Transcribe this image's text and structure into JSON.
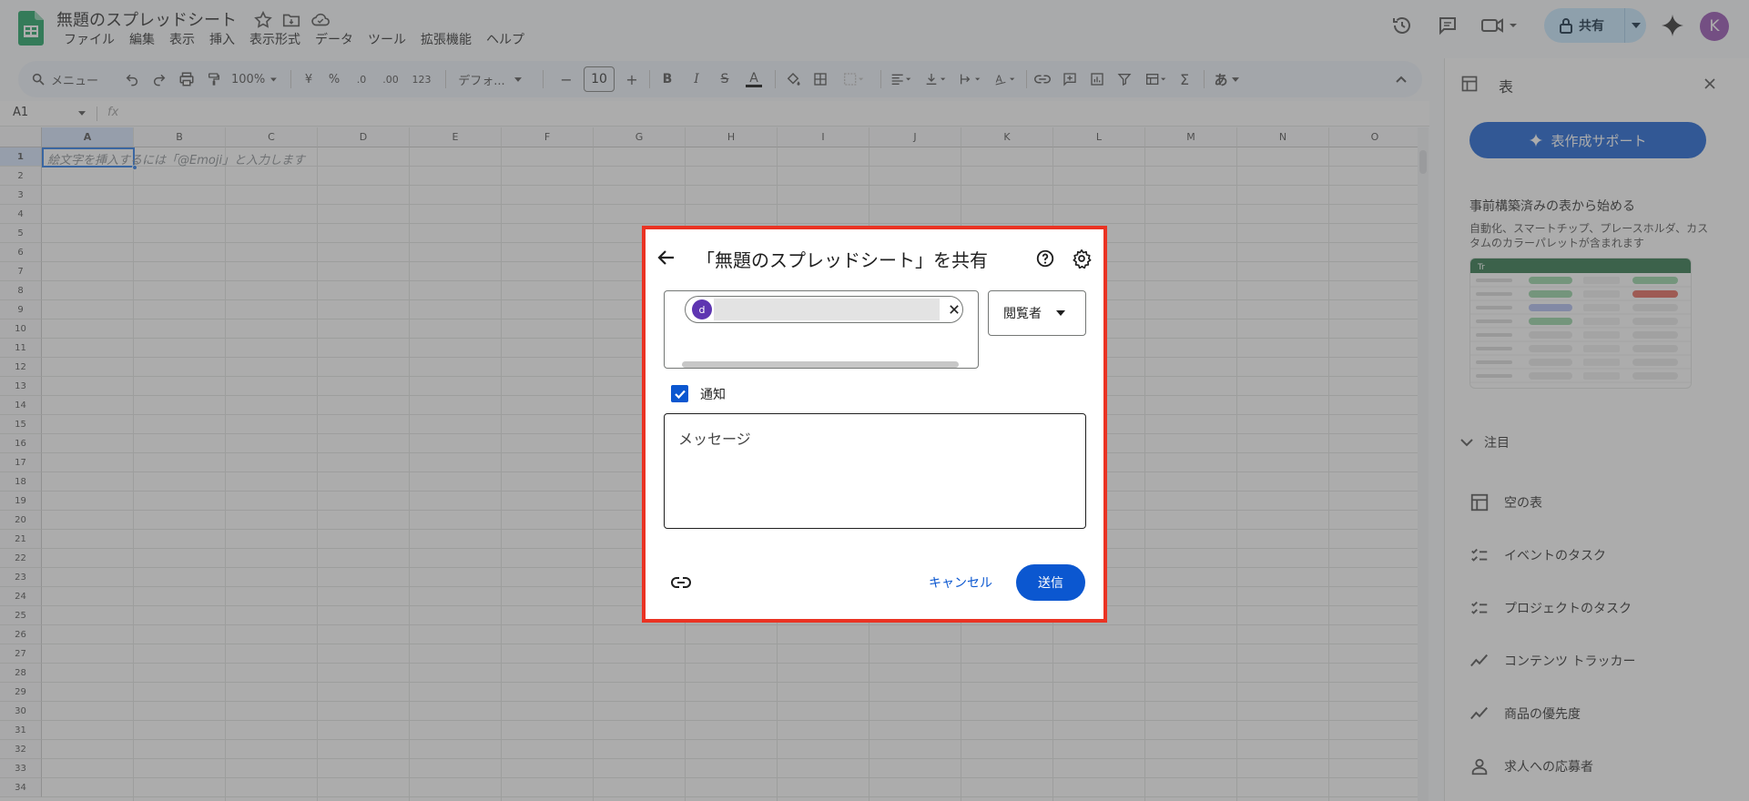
{
  "app": {
    "doc_title": "無題のスプレッドシート",
    "menus": [
      "ファイル",
      "編集",
      "表示",
      "挿入",
      "表示形式",
      "データ",
      "ツール",
      "拡張機能",
      "ヘルプ"
    ],
    "share_label": "共有",
    "avatar_letter": "K"
  },
  "toolbar": {
    "search_label": "メニュー",
    "zoom": "100%",
    "currency": "¥",
    "percent": "%",
    "dec_decrease": ".0",
    "dec_increase": ".00",
    "number_format": "123",
    "font": "デフォ...",
    "font_size": "10",
    "input_mode": "あ"
  },
  "formula_bar": {
    "name_box": "A1",
    "fx": "fx"
  },
  "grid": {
    "columns": [
      "A",
      "B",
      "C",
      "D",
      "E",
      "F",
      "G",
      "H",
      "I",
      "J",
      "K",
      "L",
      "M",
      "N",
      "O"
    ],
    "rows": [
      "1",
      "2",
      "3",
      "4",
      "5",
      "6",
      "7",
      "8",
      "9",
      "10",
      "11",
      "12",
      "13",
      "14",
      "15",
      "16",
      "17",
      "18",
      "19",
      "20",
      "21",
      "22",
      "23",
      "24",
      "25",
      "26",
      "27",
      "28",
      "29",
      "30",
      "31",
      "32",
      "33",
      "34"
    ],
    "cell_a1_hint": "絵文字を挿入するには「@Emoji」と入力します"
  },
  "side_panel": {
    "title": "表",
    "assist_button": "表作成サポート",
    "prebuilt_heading": "事前構築済みの表から始める",
    "prebuilt_desc": "自動化、スマートチップ、プレースホルダ、カスタムのカラーパレットが含まれます",
    "preview_header": "Tr",
    "attention": "注目",
    "templates": [
      "空の表",
      "イベントのタスク",
      "プロジェクトのタスク",
      "コンテンツ トラッカー",
      "商品の優先度",
      "求人への応募者"
    ]
  },
  "dialog": {
    "title": "「無題のスプレッドシート」を共有",
    "chip_avatar": "d",
    "role": "閲覧者",
    "notify_label": "通知",
    "notify_checked": true,
    "message_placeholder": "メッセージ",
    "cancel_label": "キャンセル",
    "send_label": "送信"
  },
  "colors": {
    "accent": "#0b57d0",
    "highlight_border": "#ea3323",
    "share_bg": "#c2e7ff"
  }
}
